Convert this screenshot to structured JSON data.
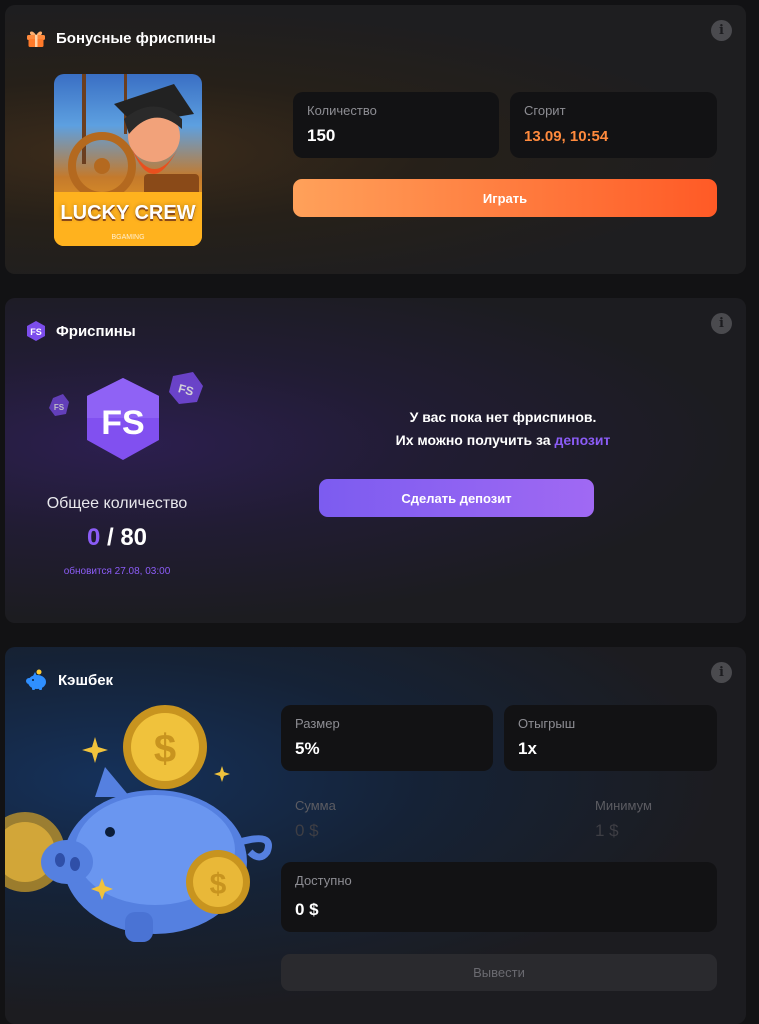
{
  "bonus_freespins": {
    "title": "Бонусные фриспины",
    "game": {
      "name": "LUCKY CREW",
      "provider": "BGAMING"
    },
    "quantity_label": "Количество",
    "quantity_value": "150",
    "expires_label": "Сгорит",
    "expires_value": "13.09, 10:54",
    "play_label": "Играть"
  },
  "freespins": {
    "title": "Фриспины",
    "badge_text": "FS",
    "total_label": "Общее количество",
    "used": "0",
    "separator": " / ",
    "total": "80",
    "updated": "обновится 27.08, 03:00",
    "empty_line1": "У вас пока нет фриспинов.",
    "empty_line2_prefix": "Их можно получить за ",
    "empty_line2_link": "депозит",
    "deposit_button": "Сделать депозит"
  },
  "cashback": {
    "title": "Кэшбек",
    "size_label": "Размер",
    "size_value": "5%",
    "wager_label": "Отыгрыш",
    "wager_value": "1x",
    "sum_label": "Сумма",
    "sum_value": "0 $",
    "min_label": "Минимум",
    "min_value": "1 $",
    "available_label": "Доступно",
    "available_value": "0 $",
    "withdraw_button": "Вывести"
  },
  "colors": {
    "orange_accent": "#ff8a3d",
    "purple_accent": "#8b5cf6",
    "play_gradient": [
      "#ffa15a",
      "#ff5a26"
    ],
    "deposit_gradient": [
      "#7c5cf0",
      "#a069f3"
    ]
  },
  "icons": {
    "bonus": "gift-icon",
    "freespins": "fs-badge-icon",
    "cashback": "piggy-bank-icon",
    "info": "info-icon"
  }
}
